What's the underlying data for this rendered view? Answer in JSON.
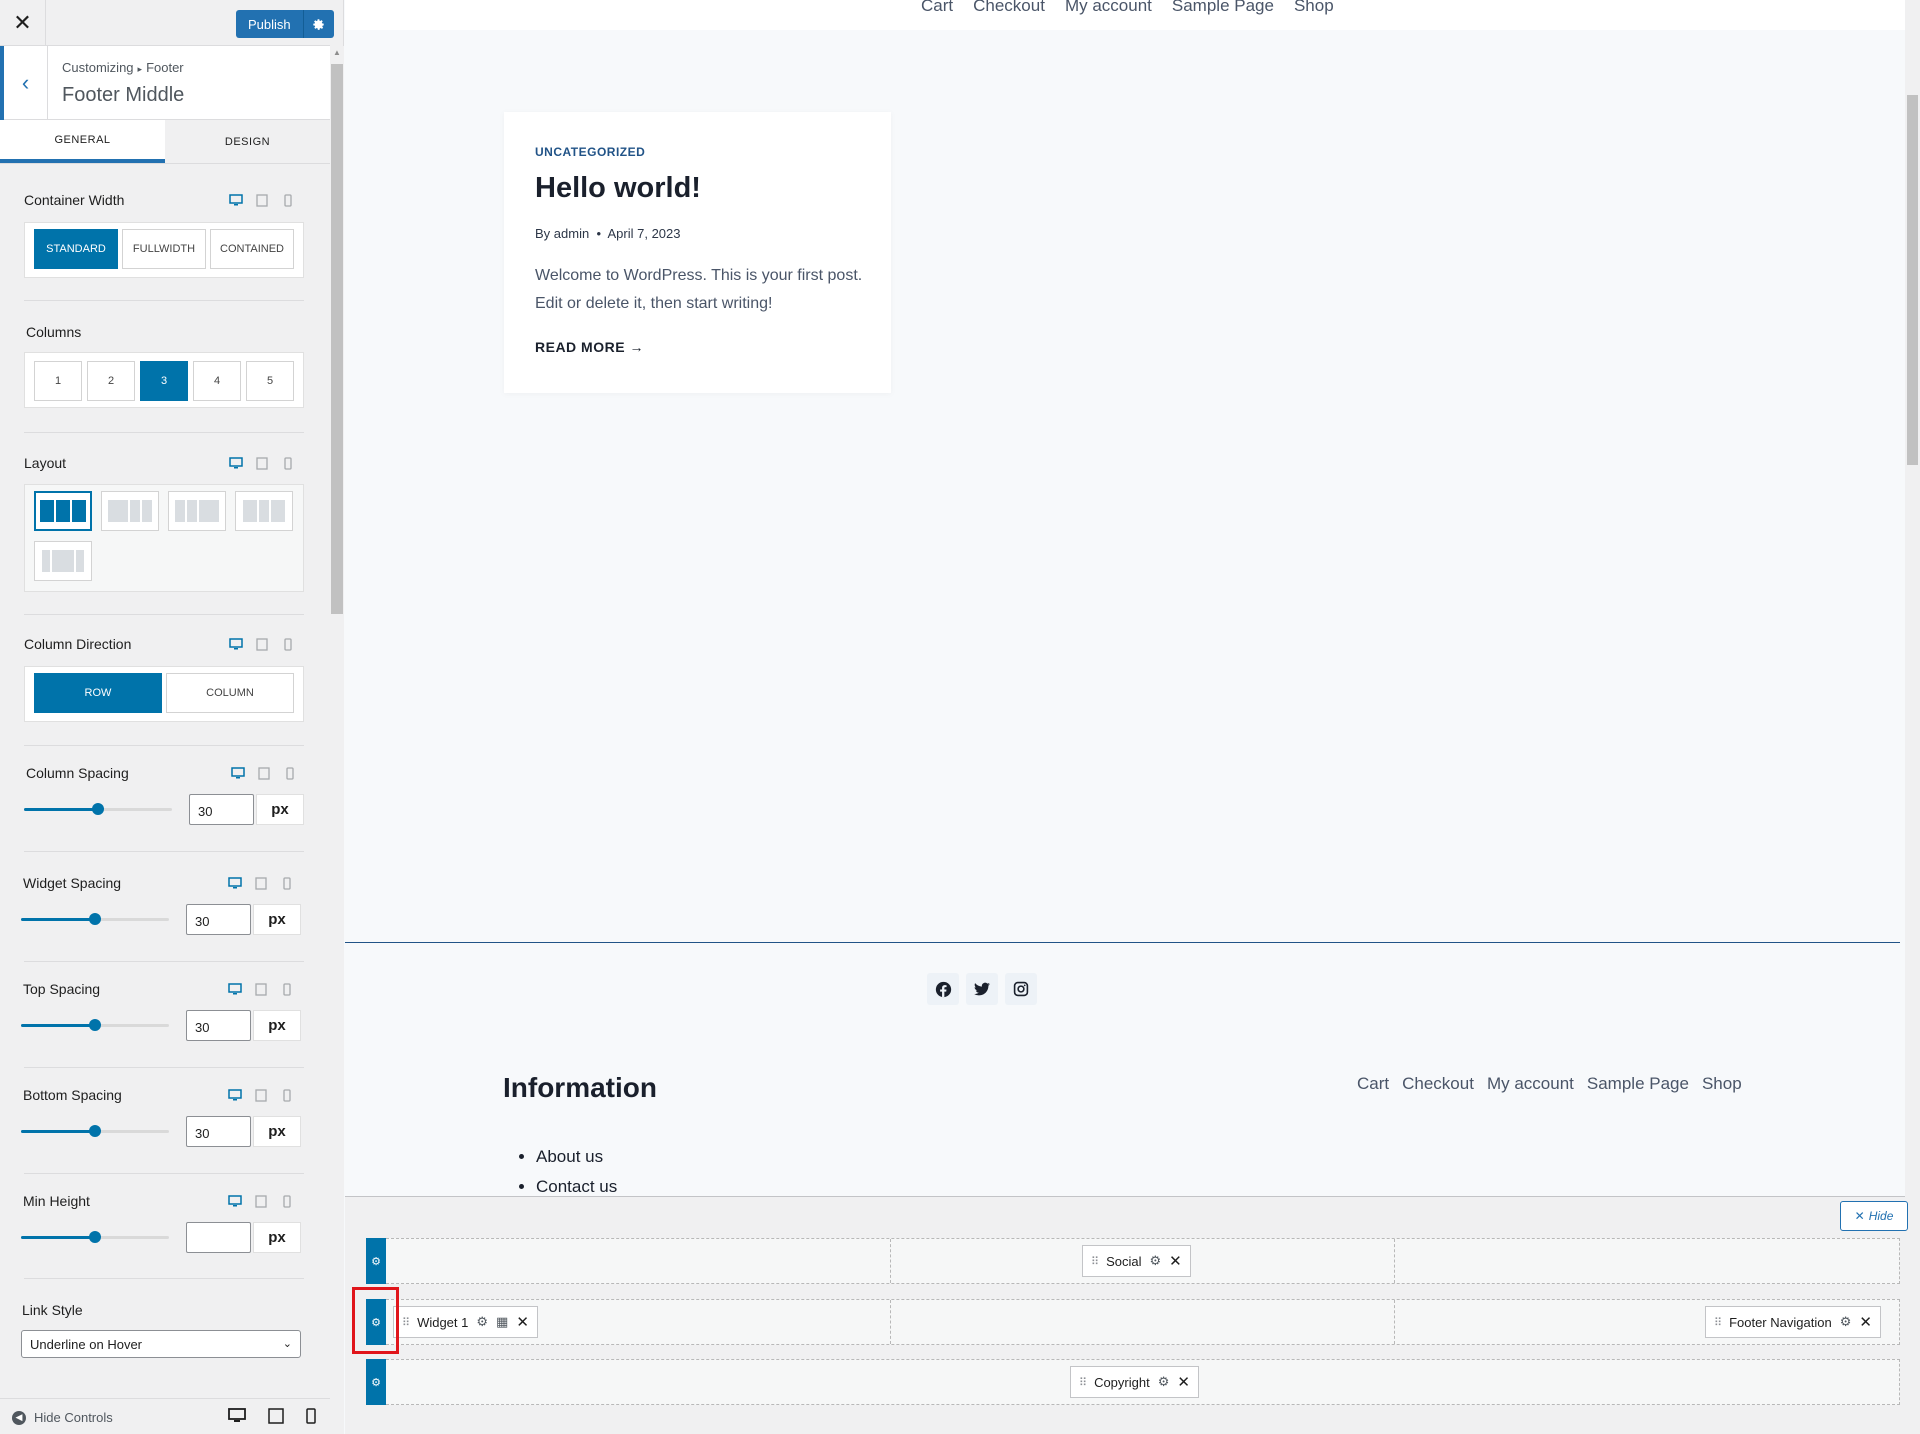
{
  "topbar": {
    "close": "✕",
    "publish_label": "Publish",
    "publish_gear_icon": "gear-icon"
  },
  "section": {
    "breadcrumb_parent": "Customizing",
    "breadcrumb_child": "Footer",
    "title": "Footer Middle"
  },
  "tabs": [
    {
      "label": "GENERAL",
      "active": true
    },
    {
      "label": "DESIGN",
      "active": false
    }
  ],
  "controls": {
    "container_width": {
      "label": "Container Width",
      "options": [
        "STANDARD",
        "FULLWIDTH",
        "CONTAINED"
      ],
      "selected": "STANDARD"
    },
    "columns": {
      "label": "Columns",
      "options": [
        "1",
        "2",
        "3",
        "4",
        "5"
      ],
      "selected": "3"
    },
    "layout": {
      "label": "Layout"
    },
    "column_direction": {
      "label": "Column Direction",
      "options": [
        "ROW",
        "COLUMN"
      ],
      "selected": "ROW"
    },
    "column_spacing": {
      "label": "Column Spacing",
      "value": "30",
      "unit": "px",
      "fraction": 0.5
    },
    "widget_spacing": {
      "label": "Widget Spacing",
      "value": "30",
      "unit": "px",
      "fraction": 0.5
    },
    "top_spacing": {
      "label": "Top Spacing",
      "value": "30",
      "unit": "px",
      "fraction": 0.5
    },
    "bottom_spacing": {
      "label": "Bottom Spacing",
      "value": "30",
      "unit": "px",
      "fraction": 0.5
    },
    "min_height": {
      "label": "Min Height",
      "value": "",
      "unit": "px",
      "fraction": 0.5
    },
    "link_style": {
      "label": "Link Style",
      "value": "Underline on Hover"
    }
  },
  "footer_bar": {
    "hide_controls": "Hide Controls"
  },
  "preview": {
    "top_nav": [
      "Cart",
      "Checkout",
      "My account",
      "Sample Page",
      "Shop"
    ],
    "post": {
      "category": "UNCATEGORIZED",
      "title": "Hello world!",
      "meta_by": "By",
      "meta_author": "admin",
      "meta_date": "April 7, 2023",
      "excerpt": "Welcome to WordPress. This is your first post. Edit or delete it, then start writing!",
      "read_more": "READ MORE →"
    },
    "footer": {
      "social_icons": [
        "facebook-icon",
        "twitter-icon",
        "instagram-icon"
      ],
      "info_title": "Information",
      "info_links": [
        "About us",
        "Contact us"
      ],
      "nav": [
        "Cart",
        "Checkout",
        "My account",
        "Sample Page",
        "Shop"
      ]
    }
  },
  "builder": {
    "hide_label": "Hide",
    "rows": [
      {
        "items": [
          {
            "label": "Social"
          }
        ]
      },
      {
        "items": [
          {
            "label": "Widget 1"
          },
          {
            "label": "Footer Navigation"
          }
        ]
      },
      {
        "items": [
          {
            "label": "Copyright"
          }
        ]
      }
    ]
  },
  "colors": {
    "accent": "#0073aa",
    "publish": "#2271b1",
    "highlight": "#e0151b",
    "heading": "#1a202c",
    "category": "#215387"
  }
}
